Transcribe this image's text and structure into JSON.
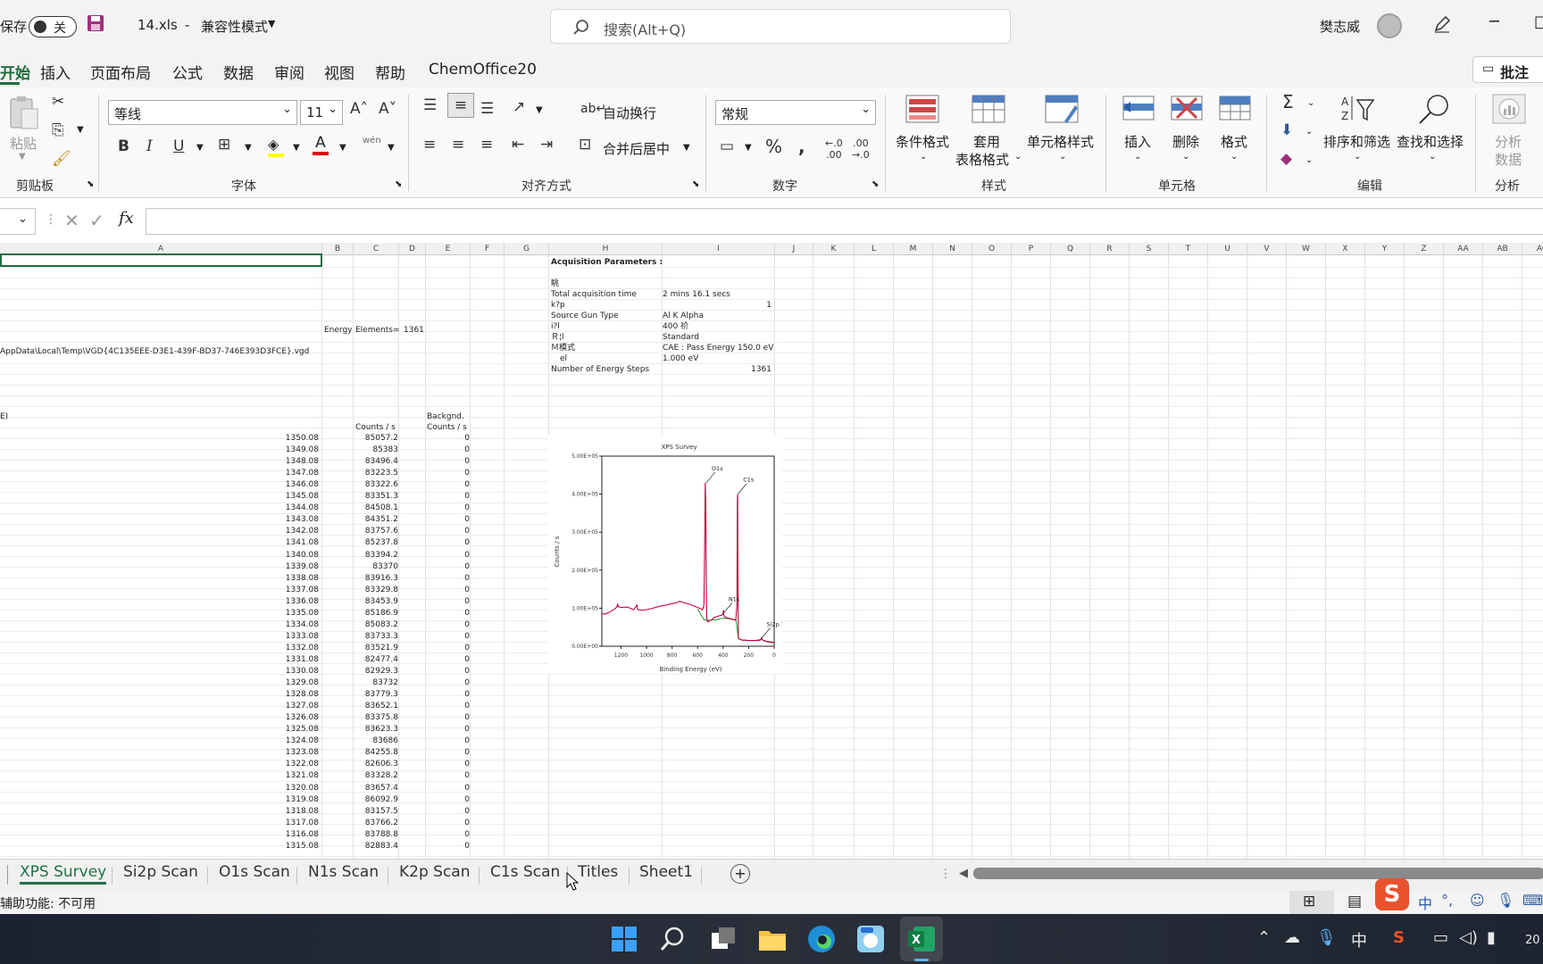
{
  "titlebar": {
    "autosave_label": "保存",
    "autosave_state": "关",
    "filename": "14.xls",
    "mode_sep": "-",
    "mode": "兼容性模式",
    "search_placeholder": "搜索(Alt+Q)",
    "username": "樊志威"
  },
  "menu": {
    "items": [
      "开始",
      "插入",
      "页面布局",
      "公式",
      "数据",
      "审阅",
      "视图",
      "帮助",
      "ChemOffice20"
    ],
    "comment_button": "批注"
  },
  "ribbon": {
    "clipboard": {
      "paste": "粘贴",
      "group": "剪贴板"
    },
    "font": {
      "name": "等线",
      "size": "11",
      "group": "字体",
      "pinyin": "wén"
    },
    "alignment": {
      "wrap": "自动换行",
      "merge": "合并后居中",
      "group": "对齐方式"
    },
    "number": {
      "format": "常规",
      "group": "数字"
    },
    "styles": {
      "conditional": "条件格式",
      "table_1": "套用",
      "table_2": "表格格式",
      "cell_styles": "单元格样式",
      "group": "样式"
    },
    "cells": {
      "insert": "插入",
      "delete": "删除",
      "format": "格式",
      "group": "单元格"
    },
    "editing": {
      "sort": "排序和筛选",
      "find": "查找和选择",
      "group": "编辑"
    },
    "analysis": {
      "label_1": "分析",
      "label_2": "数据",
      "group": "分析"
    }
  },
  "formula": {
    "fx": "fx"
  },
  "grid": {
    "columns": [
      "A",
      "B",
      "C",
      "D",
      "E",
      "F",
      "G",
      "H",
      "I",
      "J",
      "K",
      "L",
      "M",
      "N",
      "O",
      "P",
      "Q",
      "R",
      "S",
      "T",
      "U",
      "V",
      "W",
      "X",
      "Y",
      "Z",
      "AA",
      "AB",
      "AC"
    ],
    "info": {
      "energy": "Energy",
      "elements_label": "Elements=",
      "elements_value": "1361",
      "path": "AppData\\Local\\Temp\\VGD{4C135EEE-D3E1-439F-BD37-746E393D3FCE}.vgd",
      "e_label": "E)",
      "backgnd": "Backgnd.",
      "counts_c": "Counts / s",
      "counts_e": "Counts / s"
    },
    "acq": {
      "title": "Acquisition Parameters :",
      "r1": "眺",
      "r2_label": "Total acquisition time",
      "r2_value": "2 mins 16.1 secs",
      "r3_label": "k?p",
      "r3_value": "1",
      "r4_label": "Source Gun Type",
      "r4_value": "Al K Alpha",
      "r5_label": "i?l",
      "r5_value": "400 祄",
      "r6_label": "Ｒ¦l",
      "r6_value": "Standard",
      "r7_label": "Ｍ模式",
      "r7_value": "CAE : Pass Energy 150.0 eV",
      "r8_label": "el",
      "r8_value": "1.000 eV",
      "r9_label": "Number of Energy Steps",
      "r9_value": "1361"
    },
    "rows": [
      [
        "1350.08",
        "85057.2",
        "0"
      ],
      [
        "1349.08",
        "85383",
        "0"
      ],
      [
        "1348.08",
        "83496.4",
        "0"
      ],
      [
        "1347.08",
        "83223.5",
        "0"
      ],
      [
        "1346.08",
        "83322.6",
        "0"
      ],
      [
        "1345.08",
        "83351.3",
        "0"
      ],
      [
        "1344.08",
        "84508.1",
        "0"
      ],
      [
        "1343.08",
        "84351.2",
        "0"
      ],
      [
        "1342.08",
        "83757.6",
        "0"
      ],
      [
        "1341.08",
        "85237.8",
        "0"
      ],
      [
        "1340.08",
        "83394.2",
        "0"
      ],
      [
        "1339.08",
        "83370",
        "0"
      ],
      [
        "1338.08",
        "83916.3",
        "0"
      ],
      [
        "1337.08",
        "83329.8",
        "0"
      ],
      [
        "1336.08",
        "83453.9",
        "0"
      ],
      [
        "1335.08",
        "85186.9",
        "0"
      ],
      [
        "1334.08",
        "85083.2",
        "0"
      ],
      [
        "1333.08",
        "83733.3",
        "0"
      ],
      [
        "1332.08",
        "83521.9",
        "0"
      ],
      [
        "1331.08",
        "82477.4",
        "0"
      ],
      [
        "1330.08",
        "82929.3",
        "0"
      ],
      [
        "1329.08",
        "83732",
        "0"
      ],
      [
        "1328.08",
        "83779.3",
        "0"
      ],
      [
        "1327.08",
        "83652.1",
        "0"
      ],
      [
        "1326.08",
        "83375.8",
        "0"
      ],
      [
        "1325.08",
        "83623.3",
        "0"
      ],
      [
        "1324.08",
        "83686",
        "0"
      ],
      [
        "1323.08",
        "84255.8",
        "0"
      ],
      [
        "1322.08",
        "82606.3",
        "0"
      ],
      [
        "1321.08",
        "83328.2",
        "0"
      ],
      [
        "1320.08",
        "83657.4",
        "0"
      ],
      [
        "1319.08",
        "86092.9",
        "0"
      ],
      [
        "1318.08",
        "83157.5",
        "0"
      ],
      [
        "1317.08",
        "83766.2",
        "0"
      ],
      [
        "1316.08",
        "83788.8",
        "0"
      ],
      [
        "1315.08",
        "82883.4",
        "0"
      ]
    ]
  },
  "chart_data": {
    "type": "line",
    "title": "XPS Survey",
    "xlabel": "Binding Energy (eV)",
    "ylabel": "Counts / s",
    "xlim": [
      1350,
      0
    ],
    "ylim": [
      0,
      500000
    ],
    "xticks": [
      "1200",
      "1000",
      "800",
      "600",
      "400",
      "200",
      "0"
    ],
    "yticks": [
      "0.00E+00",
      "1.00E+05",
      "2.00E+05",
      "3.00E+05",
      "4.00E+05",
      "5.00E+05"
    ],
    "grid": false,
    "series": [
      {
        "color": "#c0003a",
        "x": [
          1350,
          1320,
          1290,
          1250,
          1230,
          1226,
          1222,
          1200,
          1150,
          1100,
          1075,
          1071,
          1067,
          1040,
          1000,
          950,
          900,
          850,
          800,
          760,
          740,
          720,
          700,
          660,
          630,
          600,
          580,
          560,
          550,
          545,
          540,
          536,
          532,
          529,
          526,
          524,
          520,
          510,
          500,
          490,
          480,
          470,
          450,
          430,
          410,
          400,
          398,
          396,
          394,
          380,
          360,
          340,
          320,
          300,
          292,
          288,
          286,
          284,
          282,
          280,
          270,
          250,
          230,
          200,
          150,
          130,
          110,
          101,
          99,
          97,
          80,
          60,
          40,
          20,
          0
        ],
        "y": [
          85000,
          85000,
          90000,
          98000,
          104000,
          112000,
          104000,
          102000,
          103000,
          96000,
          108000,
          98000,
          96000,
          95000,
          96000,
          100000,
          105000,
          108000,
          112000,
          115000,
          118000,
          116000,
          114000,
          110000,
          106000,
          102000,
          99000,
          96000,
          110000,
          250000,
          430000,
          380000,
          180000,
          80000,
          70000,
          65000,
          64000,
          66000,
          68000,
          70000,
          72000,
          76000,
          78000,
          80000,
          82000,
          86000,
          95000,
          88000,
          80000,
          76000,
          74000,
          72000,
          70000,
          69000,
          110000,
          390000,
          400000,
          200000,
          60000,
          22000,
          18000,
          16000,
          16000,
          15000,
          15000,
          15000,
          16000,
          20000,
          24000,
          18000,
          14000,
          13000,
          12000,
          11000,
          10000
        ]
      },
      {
        "color": "#2e9e3e",
        "x": [
          600,
          550,
          500,
          450,
          400,
          350,
          300,
          280,
          250,
          200,
          150,
          100,
          50,
          0
        ],
        "y": [
          98000,
          70000,
          68000,
          70000,
          74000,
          72000,
          70000,
          20000,
          16000,
          15000,
          15000,
          18000,
          11000,
          9000
        ]
      }
    ],
    "annotations": [
      {
        "label": "O1s",
        "x": 532,
        "y": 430000
      },
      {
        "label": "C1s",
        "x": 285,
        "y": 400000
      },
      {
        "label": "N1s",
        "x": 400,
        "y": 86000
      },
      {
        "label": "Si2p ???",
        "x": 101,
        "y": 20000
      }
    ]
  },
  "sheets": {
    "tabs": [
      "XPS Survey",
      "Si2p Scan",
      "O1s Scan",
      "N1s Scan",
      "K2p Scan",
      "C1s Scan",
      "Titles",
      "Sheet1"
    ],
    "active": "XPS Survey"
  },
  "status": {
    "accessibility": "辅助功能: 不可用"
  },
  "taskbar": {
    "ime": "中",
    "time_fragment": "20"
  }
}
